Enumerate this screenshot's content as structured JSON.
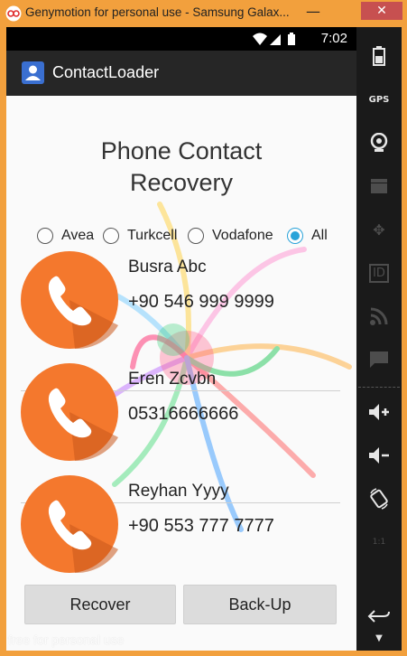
{
  "window": {
    "title": "Genymotion for personal use - Samsung Galax...",
    "minimize_icon": "minimize-icon",
    "close_icon": "close-icon",
    "close_color": "#c75050"
  },
  "status_bar": {
    "time": "7:02",
    "icons": [
      "wifi-icon",
      "signal-icon",
      "battery-icon"
    ]
  },
  "action_bar": {
    "title": "ContactLoader",
    "icon": "contacts-app-icon"
  },
  "page": {
    "title_line1": "Phone Contact",
    "title_line2": "Recovery"
  },
  "operators": [
    {
      "label": "Avea",
      "checked": false
    },
    {
      "label": "Turkcell",
      "checked": false
    },
    {
      "label": "Vodafone",
      "checked": false
    },
    {
      "label": "All",
      "checked": true
    }
  ],
  "contacts": [
    {
      "name": "Busra Abc",
      "phone": "+90 546 999 9999"
    },
    {
      "name": "Eren Zcvbn",
      "phone": "05316666666"
    },
    {
      "name": "Reyhan Yyyy",
      "phone": "+90 553 777 7777"
    }
  ],
  "buttons": {
    "recover": "Recover",
    "backup": "Back-Up"
  },
  "watermark": "free for personal use",
  "toolbar": {
    "icons": [
      "battery-icon",
      "gps-icon",
      "camera-icon",
      "media-icon",
      "dpad-icon",
      "id-icon",
      "rss-icon",
      "sms-icon",
      "volume-up-icon",
      "volume-down-icon",
      "rotate-icon",
      "scale-icon",
      "back-icon",
      "more-icon"
    ],
    "gps_label": "GPS",
    "id_label": "ID",
    "scale_label": "1:1"
  },
  "colors": {
    "accent": "#29a3d9",
    "avatar": "#f4782d",
    "window_frame": "#f2a03d",
    "action_bar": "#262626"
  }
}
